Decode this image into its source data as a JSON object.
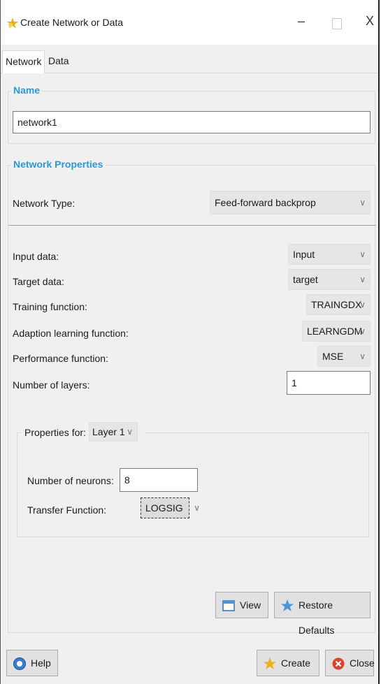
{
  "window": {
    "title": "Create Network or Data",
    "minimize_glyph": "–",
    "close_glyph": "X"
  },
  "tabs": [
    {
      "label": "Network"
    },
    {
      "label": "Data"
    }
  ],
  "name_group": {
    "legend": "Name",
    "value": "network1"
  },
  "network_properties": {
    "legend": "Network Properties",
    "network_type_label": "Network Type:",
    "network_type_value": "Feed-forward backprop",
    "input_data_label": "Input data:",
    "input_data_value": "Input",
    "target_data_label": "Target data:",
    "target_data_value": "target",
    "training_function_label": "Training function:",
    "training_function_value": "TRAINGDX",
    "adaption_label": "Adaption learning function:",
    "adaption_value": "LEARNGDM",
    "performance_label": "Performance function:",
    "performance_value": "MSE",
    "layers_label": "Number of layers:",
    "layers_value": "1"
  },
  "layer_properties": {
    "legend": "Properties for:",
    "layer_value": "Layer 1",
    "neurons_label": "Number of neurons:",
    "neurons_value": "8",
    "transfer_label": "Transfer Function:",
    "transfer_value": "LOGSIG"
  },
  "buttons": {
    "view": "View",
    "restore": "Restore Defaults",
    "help": "Help",
    "create": "Create",
    "close": "Close"
  },
  "dropdown_glyph": "∨",
  "colors": {
    "legend_blue": "#2a9ad2",
    "close_red": "#d9432f",
    "help_blue": "#3b7bd1",
    "star_yellow": "#e7b21c"
  }
}
